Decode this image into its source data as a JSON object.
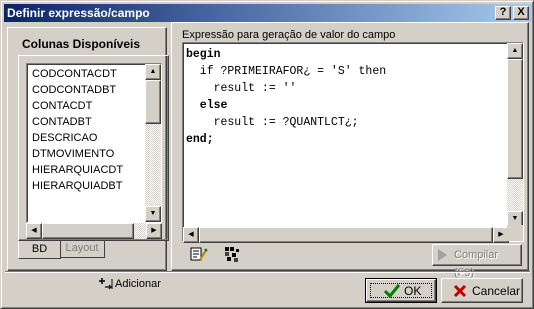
{
  "window": {
    "title": "Definir expressão/campo",
    "help_label": "?",
    "close_label": "X"
  },
  "left_panel": {
    "heading": "Colunas Disponíveis",
    "columns": [
      "CODCONTACDT",
      "CODCONTADBT",
      "CONTACDT",
      "CONTADBT",
      "DESCRICAO",
      "DTMOVIMENTO",
      "HIERARQUIACDT",
      "HIERARQUIADBT"
    ],
    "tabs": [
      {
        "label": "BD",
        "active": true
      },
      {
        "label": "Layout",
        "active": false
      }
    ],
    "add_label": "Adicionar"
  },
  "right_panel": {
    "heading": "Expressão para geração de valor do campo",
    "code_lines": [
      "begin",
      "  if ?PRIMEIRAFOR¿ = 'S' then",
      "    result := ''",
      "  else",
      "    result := ?QUANTLCT¿;",
      "end;"
    ],
    "compile_label": "Compilar (F9)"
  },
  "footer": {
    "ok_label": "OK",
    "cancel_label": "Cancelar"
  },
  "colors": {
    "title_gradient_start": "#0a246a",
    "title_gradient_end": "#a6caf0",
    "face": "#d4d0c8",
    "ok_check": "#008000",
    "cancel_x": "#c00000"
  }
}
